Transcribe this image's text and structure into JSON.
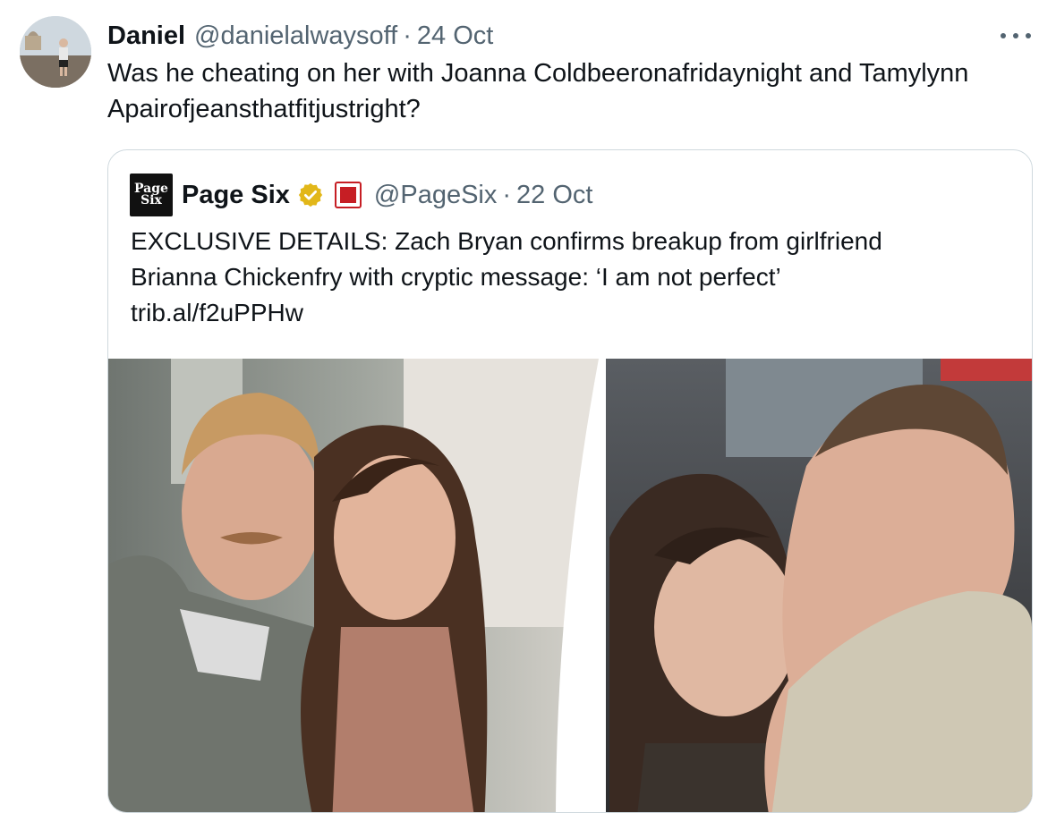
{
  "tweet": {
    "author_name": "Daniel",
    "author_handle": "@danielalwaysoff",
    "separator": "·",
    "timestamp": "24 Oct",
    "text": "Was he cheating on her with Joanna Coldbeeronafridaynight and Tamylynn Apairofjeansthatfitjustright?"
  },
  "quoted_tweet": {
    "logo_text_line1": "Page",
    "logo_text_line2": "Six",
    "author_name": "Page Six",
    "verified_badge": "verified-gold-icon",
    "affiliate_badge": "new-york-post-icon",
    "author_handle": "@PageSix",
    "separator": "·",
    "timestamp": "22 Oct",
    "text_line1": "EXCLUSIVE DETAILS: Zach Bryan confirms breakup from girlfriend",
    "text_line2": "Brianna Chickenfry with cryptic message: ‘I am not perfect’",
    "link": "trib.al/f2uPPHw"
  },
  "colors": {
    "text_primary": "#0f1419",
    "text_secondary": "#536471",
    "border": "#cfd9de",
    "verified_gold": "#e2b719"
  }
}
